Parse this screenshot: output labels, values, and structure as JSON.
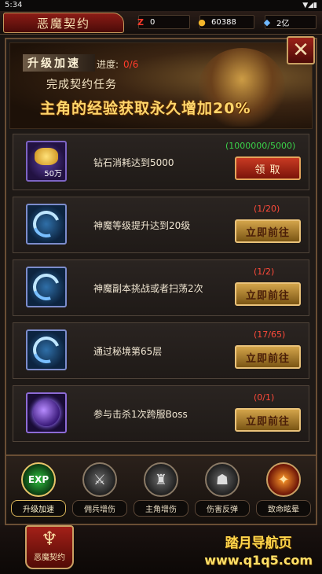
{
  "status_bar": {
    "time": "5:34"
  },
  "header": {
    "title": "恶魔契约",
    "resources": [
      {
        "icon": "z-currency-icon",
        "value": "0"
      },
      {
        "icon": "gold-coins-icon",
        "value": "60388"
      },
      {
        "icon": "diamond-icon",
        "value": "2亿"
      }
    ]
  },
  "banner": {
    "tag": "升级加速",
    "progress_label": "进度:",
    "progress_value": "0/6",
    "subtitle": "完成契约任务",
    "headline": "主角的经验获取永久增加20%"
  },
  "tasks": [
    {
      "icon": "gold-ingot-icon",
      "icon_qty": "50万",
      "desc": "钻石消耗达到5000",
      "count": "(1000000/5000)",
      "count_color": "green",
      "button": "领 取",
      "button_style": "red"
    },
    {
      "icon": "blue-swirl-icon",
      "icon_qty": "",
      "desc": "神魔等级提升达到20级",
      "count": "(1/20)",
      "count_color": "red",
      "button": "立即前往",
      "button_style": "gold"
    },
    {
      "icon": "blue-swirl-icon",
      "icon_qty": "",
      "desc": "神魔副本挑战或者扫荡2次",
      "count": "(1/2)",
      "count_color": "red",
      "button": "立即前往",
      "button_style": "gold"
    },
    {
      "icon": "blue-swirl-icon",
      "icon_qty": "",
      "desc": "通过秘境第65层",
      "count": "(17/65)",
      "count_color": "red",
      "button": "立即前往",
      "button_style": "gold"
    },
    {
      "icon": "purple-orb-icon",
      "icon_qty": "",
      "desc": "参与击杀1次跨服Boss",
      "count": "(0/1)",
      "count_color": "red",
      "button": "立即前往",
      "button_style": "gold"
    }
  ],
  "bottom_nav": [
    {
      "label": "升级加速",
      "glyph": "EXP",
      "active": true
    },
    {
      "label": "佣兵增伤",
      "glyph": "⚔",
      "active": false
    },
    {
      "label": "主角增伤",
      "glyph": "♜",
      "active": false
    },
    {
      "label": "伤害反弹",
      "glyph": "☗",
      "active": false
    },
    {
      "label": "致命眩晕",
      "glyph": "✦",
      "active": false
    }
  ],
  "footer": {
    "contract_button": "恶魔契约",
    "watermark_line1": "踏月导航页",
    "watermark_line2": "www.q1q5.com"
  }
}
